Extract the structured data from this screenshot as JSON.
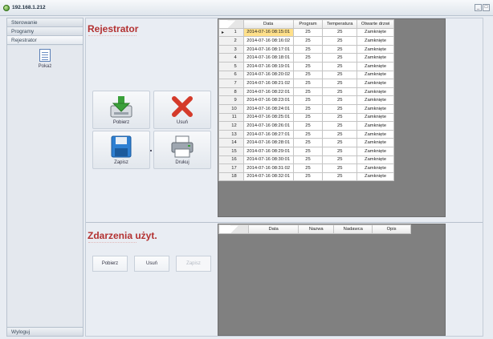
{
  "window": {
    "title": "192.168.1.212",
    "controls": [
      "_",
      "□"
    ]
  },
  "sidebar": {
    "items": [
      {
        "label": "Sterowanie"
      },
      {
        "label": "Programy"
      },
      {
        "label": "Rejestrator"
      }
    ],
    "tool": {
      "label": "Pokaż",
      "icon": "document-icon"
    },
    "bottom": {
      "label": "Wyloguj"
    }
  },
  "rejestrator": {
    "title": "Rejestrator",
    "buttons": {
      "download": {
        "label": "Pobierz",
        "icon": "download-icon"
      },
      "delete": {
        "label": "Usuń",
        "icon": "delete-icon"
      },
      "save": {
        "label": "Zapisz",
        "icon": "floppy-icon"
      },
      "print": {
        "label": "Drukuj",
        "icon": "printer-icon"
      }
    },
    "table": {
      "columns": [
        "Data",
        "Program",
        "Temperatura",
        "Otwarte drzwi"
      ],
      "rows": [
        [
          "1",
          "2014-07-16 08:15:01",
          "25",
          "25",
          "Zamknięte"
        ],
        [
          "2",
          "2014-07-16 08:16:02",
          "25",
          "25",
          "Zamknięte"
        ],
        [
          "3",
          "2014-07-16 08:17:01",
          "25",
          "25",
          "Zamknięte"
        ],
        [
          "4",
          "2014-07-16 08:18:01",
          "25",
          "25",
          "Zamknięte"
        ],
        [
          "5",
          "2014-07-16 08:19:01",
          "25",
          "25",
          "Zamknięte"
        ],
        [
          "6",
          "2014-07-16 08:20:02",
          "25",
          "25",
          "Zamknięte"
        ],
        [
          "7",
          "2014-07-16 08:21:02",
          "25",
          "25",
          "Zamknięte"
        ],
        [
          "8",
          "2014-07-16 08:22:01",
          "25",
          "25",
          "Zamknięte"
        ],
        [
          "9",
          "2014-07-16 08:23:01",
          "25",
          "25",
          "Zamknięte"
        ],
        [
          "10",
          "2014-07-16 08:24:01",
          "25",
          "25",
          "Zamknięte"
        ],
        [
          "11",
          "2014-07-16 08:25:01",
          "25",
          "25",
          "Zamknięte"
        ],
        [
          "12",
          "2014-07-16 08:26:01",
          "25",
          "25",
          "Zamknięte"
        ],
        [
          "13",
          "2014-07-16 08:27:01",
          "25",
          "25",
          "Zamknięte"
        ],
        [
          "14",
          "2014-07-16 08:28:01",
          "25",
          "25",
          "Zamknięte"
        ],
        [
          "15",
          "2014-07-16 08:29:01",
          "25",
          "25",
          "Zamknięte"
        ],
        [
          "16",
          "2014-07-16 08:30:01",
          "25",
          "25",
          "Zamknięte"
        ],
        [
          "17",
          "2014-07-16 08:31:02",
          "25",
          "25",
          "Zamknięte"
        ],
        [
          "18",
          "2014-07-16 08:32:01",
          "25",
          "25",
          "Zamknięte"
        ]
      ],
      "selected_row": "1"
    }
  },
  "events": {
    "title": "Zdarzenia użyt.",
    "buttons": {
      "download": {
        "label": "Pobierz"
      },
      "delete": {
        "label": "Usuń"
      },
      "save": {
        "label": "Zapisz",
        "disabled": true
      }
    },
    "table": {
      "columns": [
        "Data",
        "Nazwa",
        "Nadawca",
        "Opis"
      ]
    }
  },
  "colors": {
    "accent_title": "#b33131",
    "grid_background": "#808080",
    "selected_cell": "#ffe08a"
  }
}
